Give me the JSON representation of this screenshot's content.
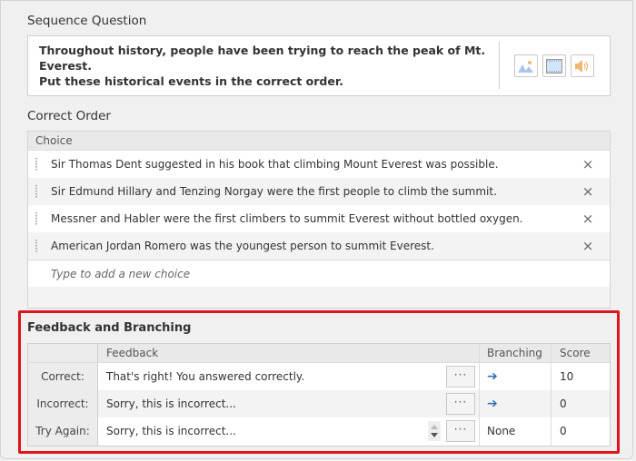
{
  "question": {
    "section_title": "Sequence Question",
    "text_line1": "Throughout history, people have been trying to reach the peak of Mt. Everest.",
    "text_line2": "Put these historical events in the correct order.",
    "media_buttons": [
      {
        "icon": "image-icon",
        "color": "#a9c8ec"
      },
      {
        "icon": "video-icon",
        "color": "#cfe6fa"
      },
      {
        "icon": "audio-icon",
        "color": "#f0b872"
      }
    ]
  },
  "correct_order": {
    "section_title": "Correct Order",
    "column_header": "Choice",
    "choices": [
      "Sir Thomas Dent suggested in his book that climbing Mount Everest was possible.",
      "Sir Edmund Hillary and Tenzing Norgay were the first people to climb the summit.",
      "Messner and Habler were the first climbers to summit Everest without bottled oxygen.",
      "American Jordan Romero was the youngest person to summit Everest."
    ],
    "remove_glyph": "×",
    "new_choice_placeholder": "Type to add a new choice"
  },
  "feedback": {
    "section_title": "Feedback and Branching",
    "highlight_color": "#e0141c",
    "columns": {
      "label": "",
      "feedback": "Feedback",
      "branching": "Branching",
      "score": "Score"
    },
    "ellipsis": "···",
    "rows": [
      {
        "label": "Correct:",
        "feedback": "That's right! You answered correctly.",
        "branching": "➔",
        "branching_type": "arrow",
        "score": "10"
      },
      {
        "label": "Incorrect:",
        "feedback": "Sorry, this is incorrect...",
        "branching": "➔",
        "branching_type": "arrow",
        "score": "0"
      },
      {
        "label": "Try Again:",
        "feedback": "Sorry, this is incorrect...",
        "branching": "None",
        "branching_type": "text",
        "score": "0"
      }
    ]
  }
}
